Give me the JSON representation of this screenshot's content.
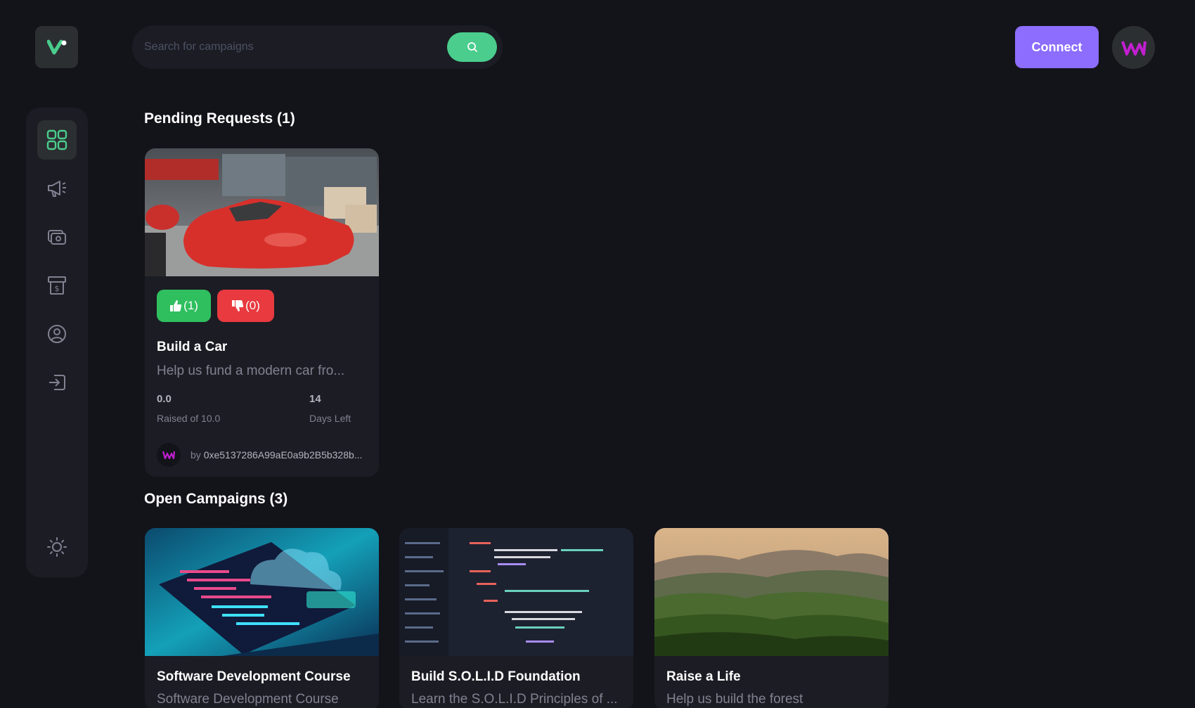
{
  "search": {
    "placeholder": "Search for campaigns"
  },
  "header": {
    "connect_label": "Connect"
  },
  "colors": {
    "accent_green": "#4acd8d",
    "accent_purple": "#8c6dfd",
    "upvote": "#2fbf5f",
    "downvote": "#e83a3f",
    "background": "#13131a",
    "card": "#1c1c24"
  },
  "sidebar": {
    "items": [
      {
        "icon": "dashboard-icon",
        "active": true
      },
      {
        "icon": "megaphone-icon",
        "active": false
      },
      {
        "icon": "payment-icon",
        "active": false
      },
      {
        "icon": "withdraw-icon",
        "active": false
      },
      {
        "icon": "profile-icon",
        "active": false
      },
      {
        "icon": "logout-icon",
        "active": false
      }
    ],
    "theme_icon": "sun-icon"
  },
  "pending": {
    "title": "Pending Requests (1)",
    "cards": [
      {
        "title": "Build a Car",
        "description": "Help us fund a modern car fro...",
        "upvotes": "(1)",
        "downvotes": "(0)",
        "raised": "0.0",
        "raised_label": "Raised of 10.0",
        "days": "14",
        "days_label": "Days Left",
        "owner_prefix": "by ",
        "owner": "0xe5137286A99aE0a9b2B5b328b..."
      }
    ]
  },
  "open": {
    "title": "Open Campaigns (3)",
    "cards": [
      {
        "title": "Software Development Course",
        "description": "Software Development Course"
      },
      {
        "title": "Build S.O.L.I.D Foundation",
        "description": "Learn the S.O.L.I.D Principles of ..."
      },
      {
        "title": "Raise a Life",
        "description": "Help us build the forest"
      }
    ]
  }
}
